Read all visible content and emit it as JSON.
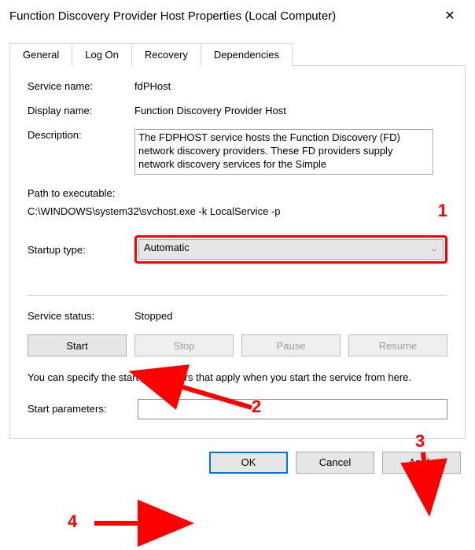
{
  "window": {
    "title": "Function Discovery Provider Host Properties (Local Computer)"
  },
  "tabs": {
    "general": "General",
    "logon": "Log On",
    "recovery": "Recovery",
    "dependencies": "Dependencies"
  },
  "fields": {
    "service_name_label": "Service name:",
    "service_name_value": "fdPHost",
    "display_name_label": "Display name:",
    "display_name_value": "Function Discovery Provider Host",
    "description_label": "Description:",
    "description_value": "The FDPHOST service hosts the Function Discovery (FD) network discovery providers. These FD providers supply network discovery services for the Simple",
    "path_label": "Path to executable:",
    "path_value": "C:\\WINDOWS\\system32\\svchost.exe -k LocalService -p",
    "startup_label": "Startup type:",
    "startup_value": "Automatic",
    "status_label": "Service status:",
    "status_value": "Stopped",
    "help_text": "You can specify the start parameters that apply when you start the service from here.",
    "start_params_label": "Start parameters:",
    "start_params_value": ""
  },
  "buttons": {
    "start": "Start",
    "stop": "Stop",
    "pause": "Pause",
    "resume": "Resume",
    "ok": "OK",
    "cancel": "Cancel",
    "apply": "Apply"
  },
  "annotations": {
    "n1": "1",
    "n2": "2",
    "n3": "3",
    "n4": "4"
  }
}
